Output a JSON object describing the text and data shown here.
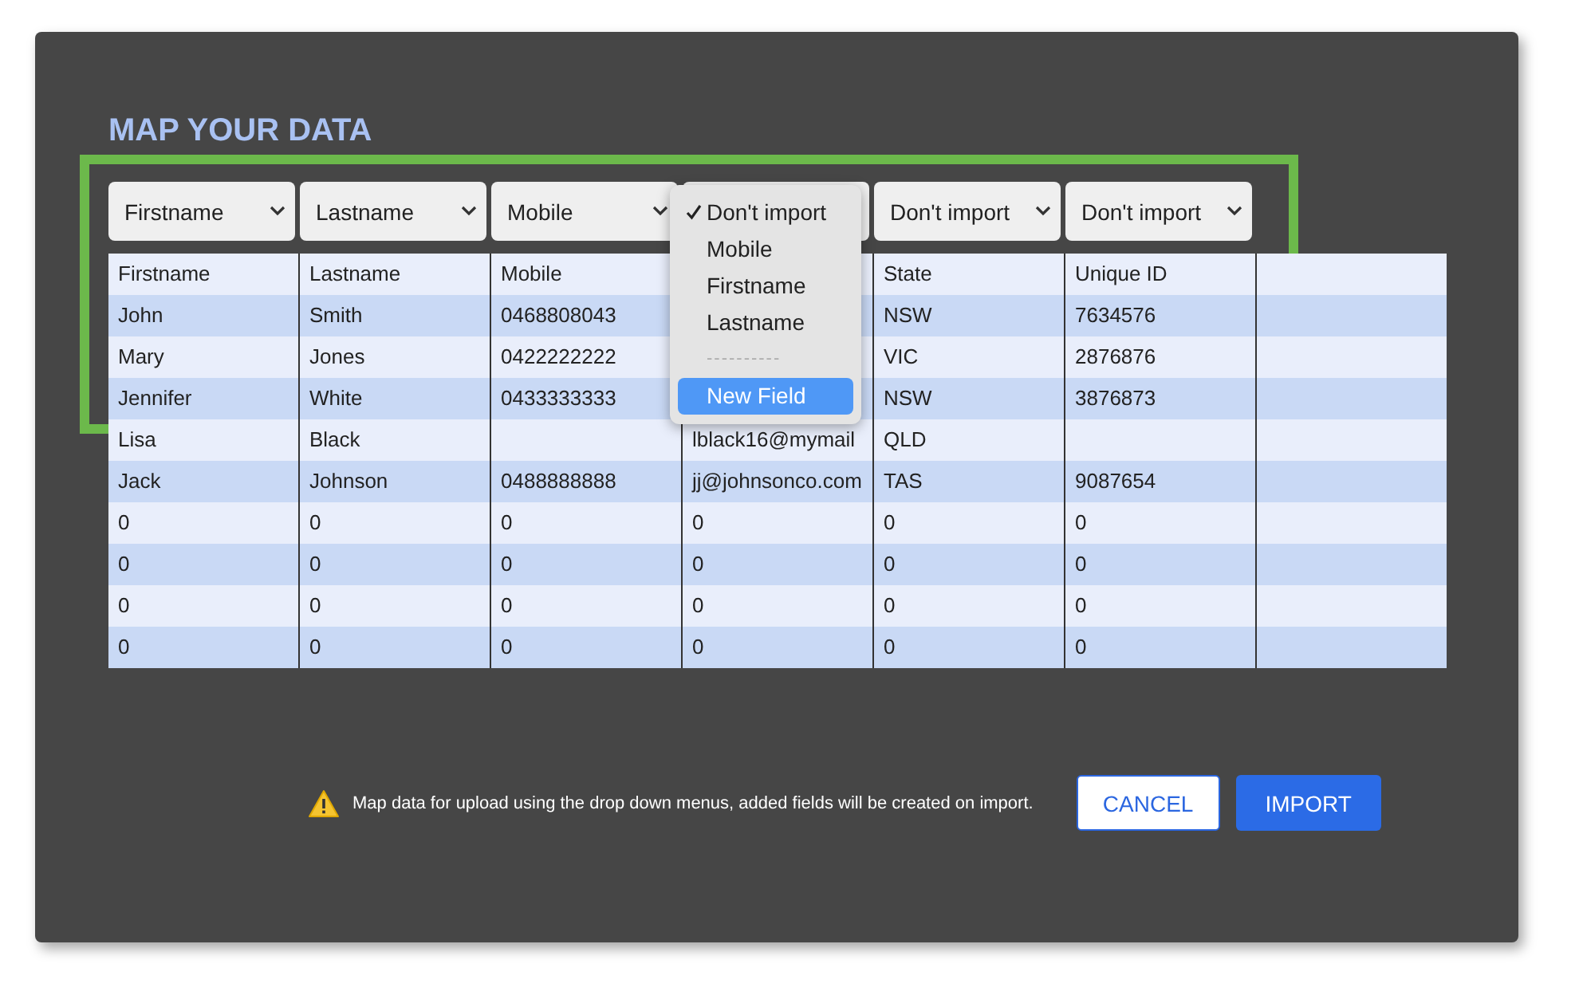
{
  "title": "MAP YOUR DATA",
  "selects": [
    {
      "value": "Firstname",
      "open": false
    },
    {
      "value": "Lastname",
      "open": false
    },
    {
      "value": "Mobile",
      "open": false
    },
    {
      "open": true
    },
    {
      "value": "Don't import",
      "open": false
    },
    {
      "value": "Don't import",
      "open": false
    }
  ],
  "menu": {
    "items": [
      {
        "kind": "option",
        "label": "Don't import",
        "checked": true,
        "highlighted": false
      },
      {
        "kind": "option",
        "label": "Mobile",
        "checked": false,
        "highlighted": false
      },
      {
        "kind": "option",
        "label": "Firstname",
        "checked": false,
        "highlighted": false
      },
      {
        "kind": "option",
        "label": "Lastname",
        "checked": false,
        "highlighted": false
      },
      {
        "kind": "separator",
        "label": "----------"
      },
      {
        "kind": "option",
        "label": "New Field",
        "checked": false,
        "highlighted": true
      }
    ]
  },
  "table": {
    "columns": [
      "Firstname",
      "Lastname",
      "Mobile",
      null,
      "State",
      "Unique ID"
    ],
    "rows": [
      [
        "John",
        "Smith",
        "0468808043",
        null,
        "NSW",
        "7634576"
      ],
      [
        "Mary",
        "Jones",
        "0422222222",
        null,
        "VIC",
        "2876876"
      ],
      [
        "Jennifer",
        "White",
        "0433333333",
        null,
        "NSW",
        "3876873"
      ],
      [
        "Lisa",
        "Black",
        null,
        "lblack16@mymail",
        "QLD",
        null
      ],
      [
        "Jack",
        "Johnson",
        "0488888888",
        "jj@johnsonco.com",
        "TAS",
        "9087654"
      ],
      [
        "0",
        "0",
        "0",
        "0",
        "0",
        "0"
      ],
      [
        "0",
        "0",
        "0",
        "0",
        "0",
        "0"
      ],
      [
        "0",
        "0",
        "0",
        "0",
        "0",
        "0"
      ],
      [
        "0",
        "0",
        "0",
        "0",
        "0",
        "0"
      ]
    ]
  },
  "footer": {
    "message": "Map data for upload using the drop down menus, added fields will be created on import."
  },
  "buttons": [
    {
      "kind": "secondary",
      "label": "CANCEL"
    },
    {
      "kind": "primary",
      "label": "IMPORT"
    }
  ]
}
